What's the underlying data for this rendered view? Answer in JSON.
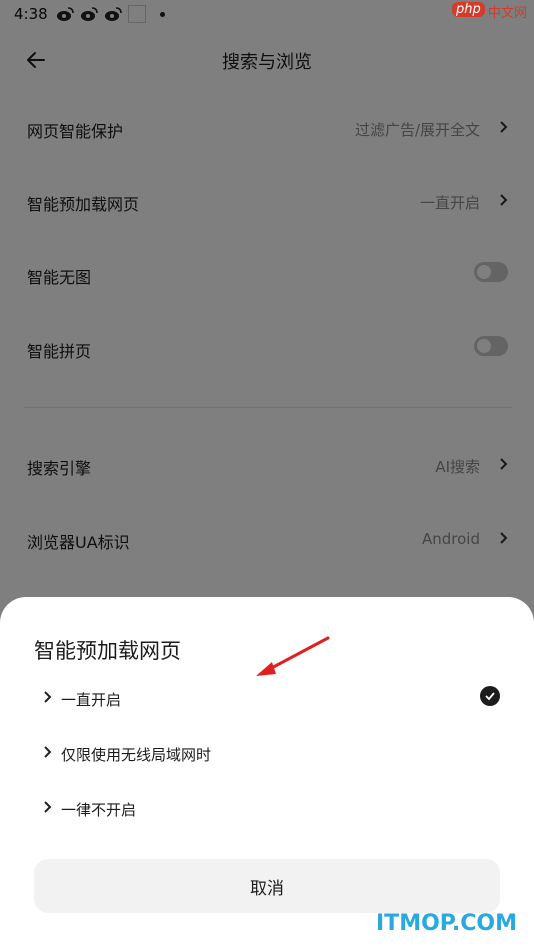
{
  "status_bar": {
    "time": "4:38"
  },
  "watermarks": {
    "php": "php",
    "cn": "中文网",
    "itmop": "ITMOP.COM"
  },
  "header": {
    "title": "搜索与浏览",
    "back_icon": "back-arrow-icon"
  },
  "settings": [
    {
      "label": "网页智能保护",
      "value": "过滤广告/展开全文",
      "type": "link"
    },
    {
      "label": "智能预加载网页",
      "value": "一直开启",
      "type": "link"
    },
    {
      "label": "智能无图",
      "type": "toggle",
      "on": false
    },
    {
      "label": "智能拼页",
      "type": "toggle",
      "on": false
    },
    {
      "label": "搜索引擎",
      "value": "AI搜索",
      "type": "link"
    },
    {
      "label": "浏览器UA标识",
      "value": "Android",
      "type": "link"
    }
  ],
  "sheet": {
    "title": "智能预加载网页",
    "options": [
      {
        "label": "一直开启",
        "selected": true
      },
      {
        "label": "仅限使用无线局域网时",
        "selected": false
      },
      {
        "label": "一律不开启",
        "selected": false
      }
    ],
    "cancel_label": "取消"
  },
  "colors": {
    "overlay": "#000000",
    "check": "#1d1d1d",
    "annotation_arrow": "#e02020",
    "watermark": "#2aa9e0"
  }
}
